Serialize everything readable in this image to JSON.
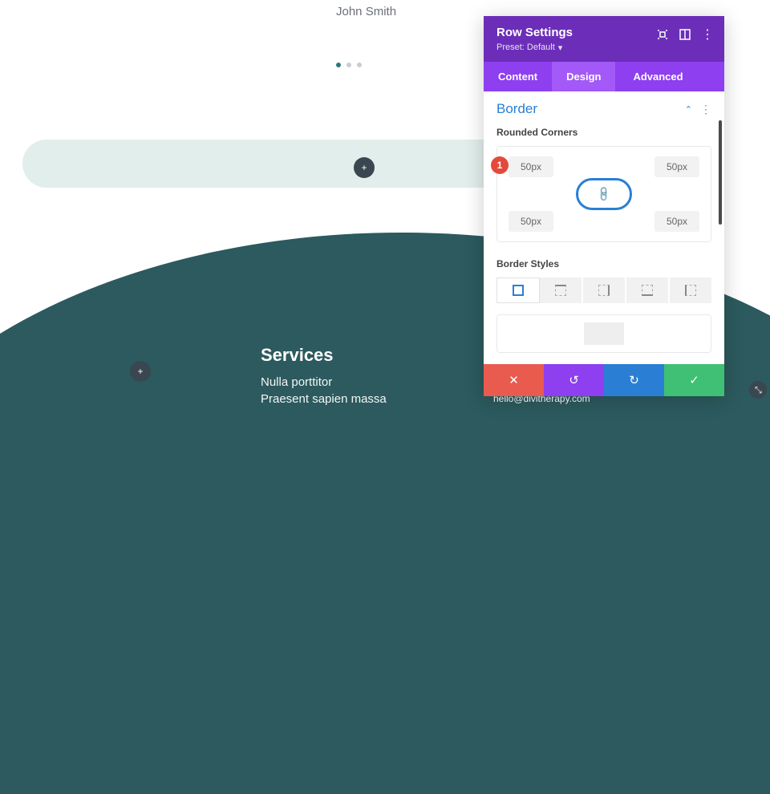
{
  "canvas": {
    "author": "John Smith",
    "services_heading": "Services",
    "services_line1": "Nulla porttitor",
    "services_line2": "Praesent sapien massa",
    "footer_email": "hello@divitherapy.com",
    "badge": "1"
  },
  "panel": {
    "title": "Row Settings",
    "preset_label": "Preset: Default",
    "tabs": {
      "content": "Content",
      "design": "Design",
      "advanced": "Advanced"
    },
    "section_border": "Border",
    "rounded_corners_label": "Rounded Corners",
    "border_styles_label": "Border Styles",
    "corners": {
      "tl": "50px",
      "tr": "50px",
      "bl": "50px",
      "br": "50px"
    }
  },
  "icons": {
    "plus": "+",
    "cross": "✕",
    "undo": "↺",
    "redo": "↻",
    "check": "✓",
    "chevron_up": "⌃",
    "kebab": "⋮",
    "link": "🔗",
    "caret_down": "▾",
    "resize": "⤢"
  }
}
